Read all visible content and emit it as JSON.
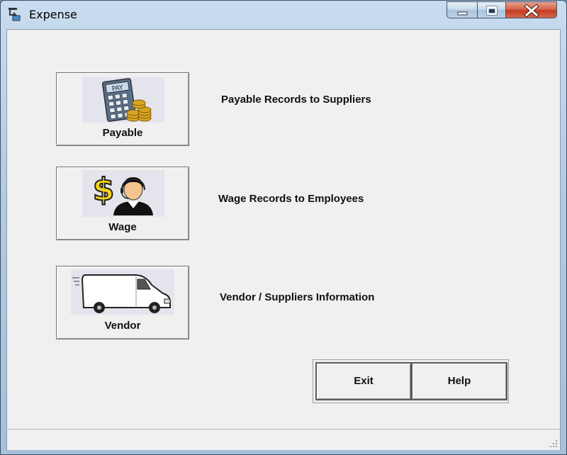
{
  "window": {
    "title": "Expense"
  },
  "buttons": [
    {
      "label": "Payable",
      "icon": "payable-calculator-coins-icon",
      "description": "Payable Records to Suppliers"
    },
    {
      "label": "Wage",
      "icon": "dollar-employee-icon",
      "description": "Wage Records to Employees"
    },
    {
      "label": "Vendor",
      "icon": "delivery-van-icon",
      "description": "Vendor / Suppliers Information"
    }
  ],
  "icon_text": {
    "pay": "PAY"
  },
  "footer": {
    "exit_label": "Exit",
    "help_label": "Help"
  },
  "colors": {
    "close_button": "#c23b22",
    "dollar_sign": "#f2d21b",
    "calculator": "#5b6f88"
  }
}
